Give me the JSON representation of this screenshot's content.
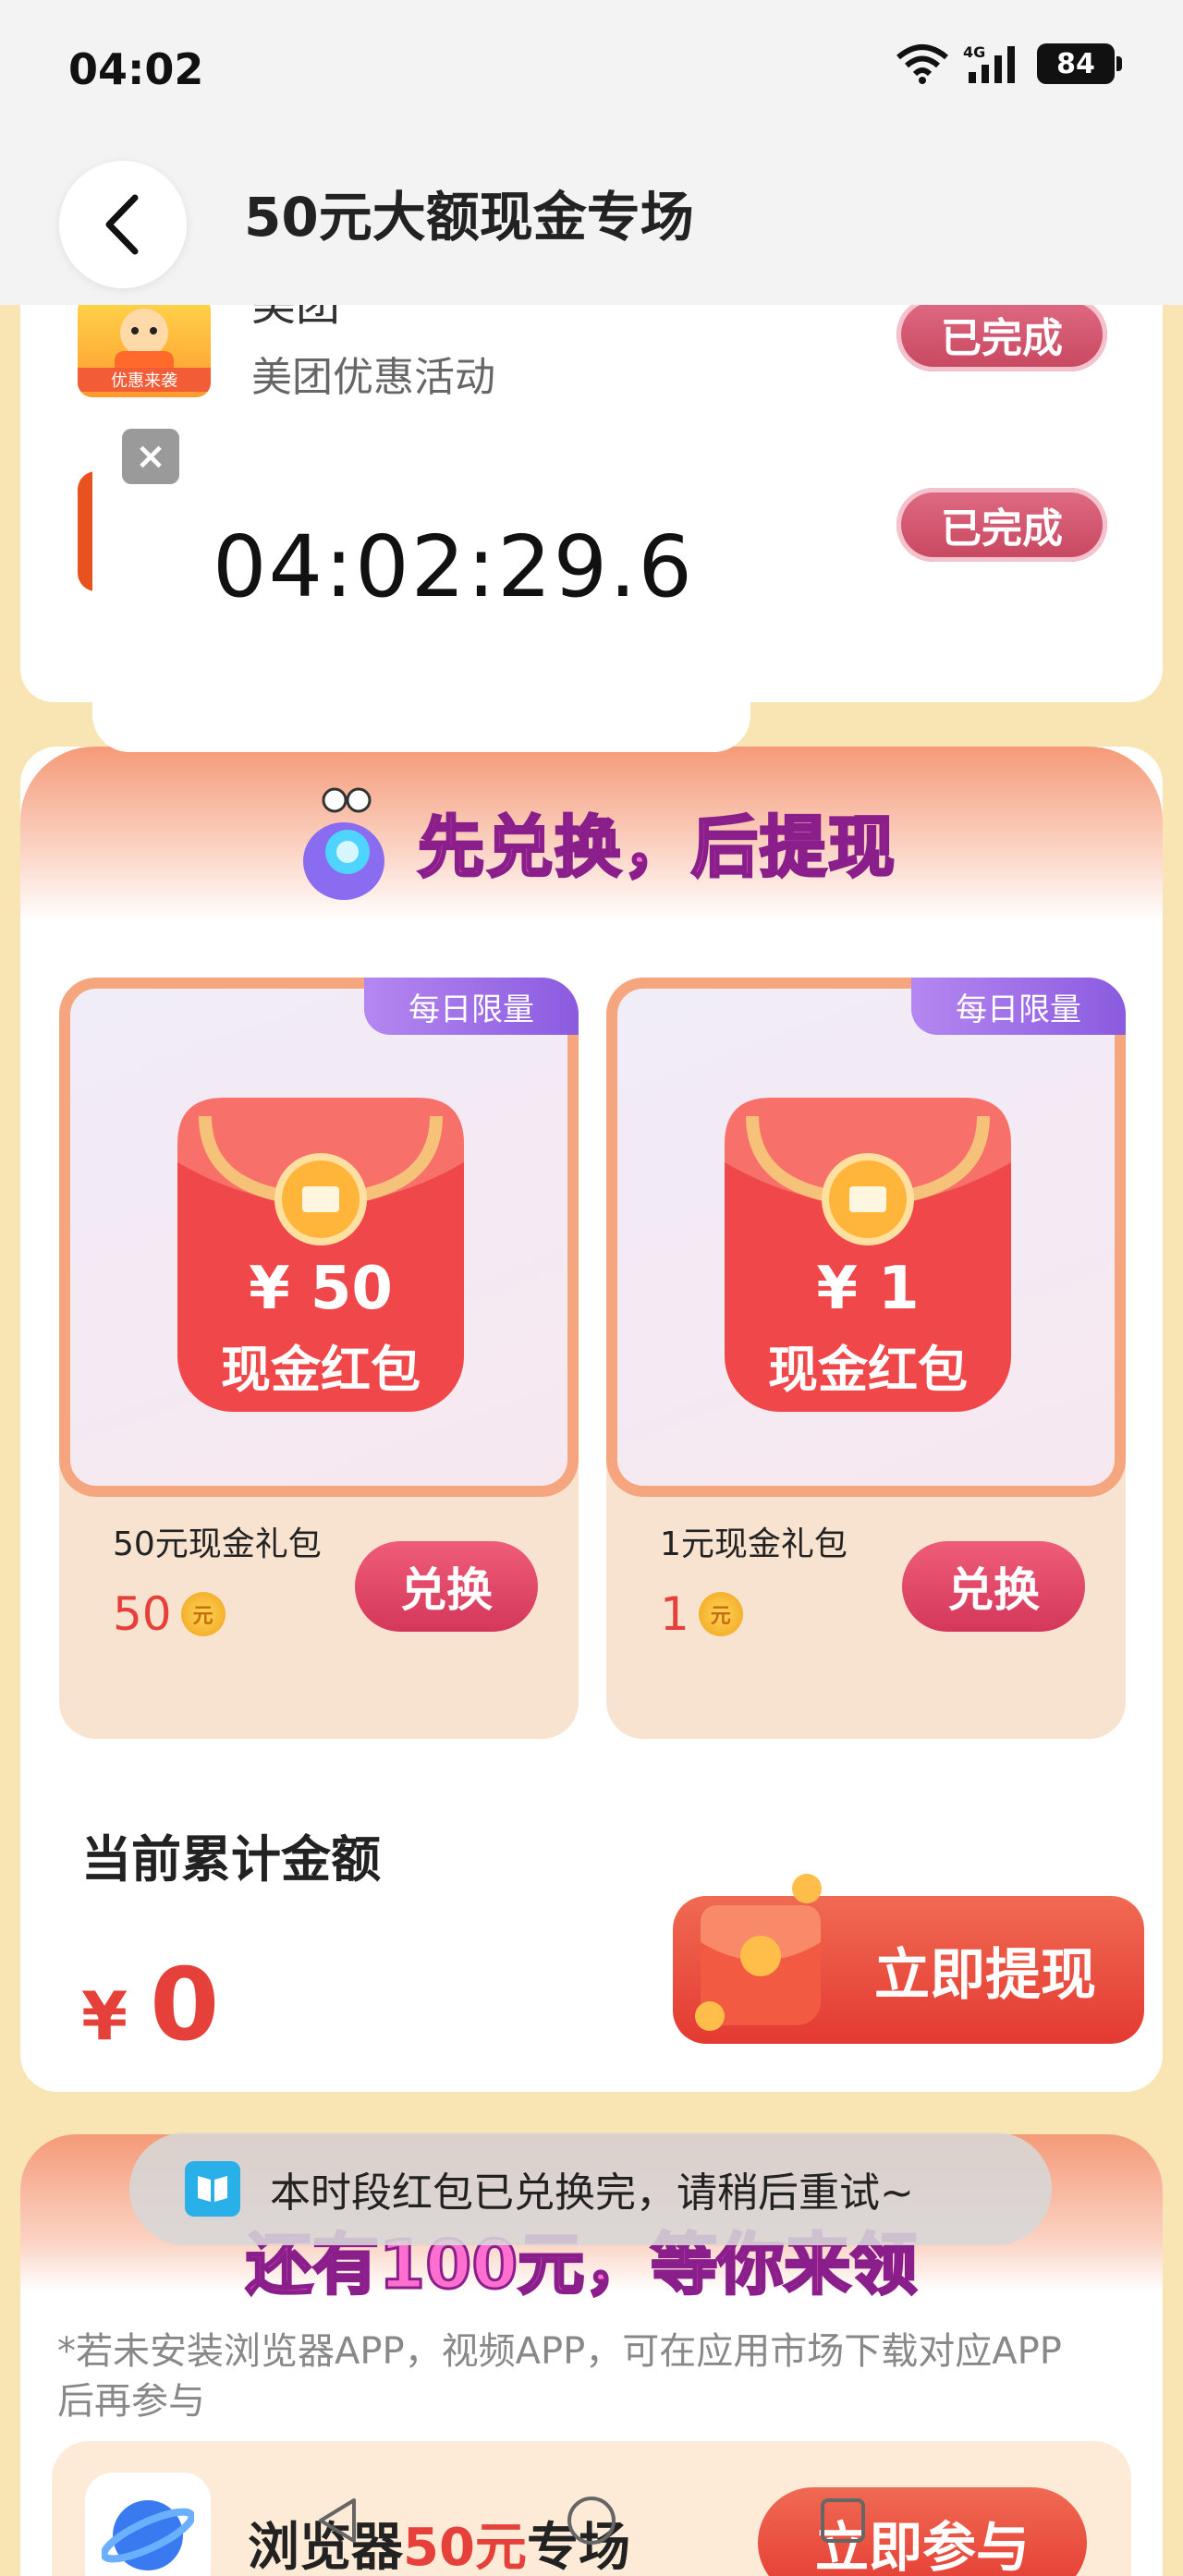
{
  "status_bar": {
    "time": "04:02",
    "network": "4G",
    "battery": "84"
  },
  "header": {
    "title": "50元大额现金专场",
    "back_icon": "chevron-left-icon"
  },
  "task_list": {
    "app_name_partial": "美团",
    "app_icon_label": "优惠来袭",
    "task_desc": "美团优惠活动",
    "done_label": "已完成"
  },
  "timer_overlay": {
    "close_label": "×",
    "time": "04:02:29.6"
  },
  "exchange": {
    "title": "先兑换，后提现",
    "coupons": [
      {
        "badge": "每日限量",
        "amount": "¥ 50",
        "pack_label": "现金红包",
        "name": "50元现金礼包",
        "price": "50",
        "coin_label": "元",
        "button": "兑换"
      },
      {
        "badge": "每日限量",
        "amount": "¥ 1",
        "pack_label": "现金红包",
        "name": "1元现金礼包",
        "price": "1",
        "coin_label": "元",
        "button": "兑换"
      }
    ],
    "total_label": "当前累计金额",
    "total_currency": "¥",
    "total_value": "0",
    "withdraw_button": "立即提现"
  },
  "bottom": {
    "title": "还有100元，等你来领",
    "note": "*若未安装浏览器APP，视频APP，可在应用市场下载对应APP后再参与",
    "browser_title_prefix": "浏览器",
    "browser_title_highlight": "50元",
    "browser_title_suffix": "专场",
    "join_button": "立即参与"
  },
  "toast": {
    "text": "本时段红包已兑换完，请稍后重试~"
  },
  "colors": {
    "accent_red": "#e5403a",
    "page_bg": "#f9e4b4",
    "done_pink": "#c7465f"
  }
}
